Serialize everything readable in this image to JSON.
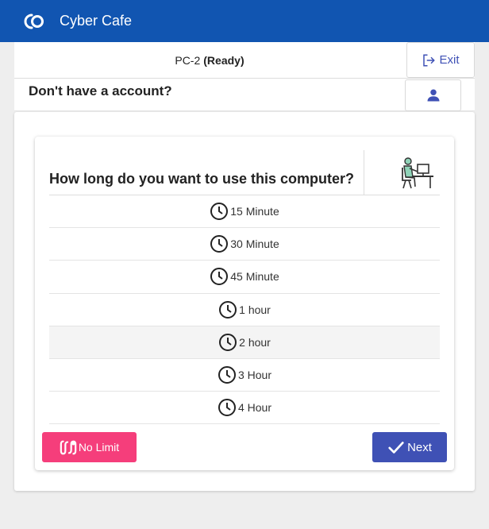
{
  "app": {
    "title": "Cyber Cafe",
    "logo_icon": "cyber-cafe-logo-icon"
  },
  "status": {
    "pc_name": "PC-2",
    "state": "(Ready)"
  },
  "exit": {
    "label": "Exit",
    "icon": "logout-icon"
  },
  "account": {
    "prompt": "Don't have a account?",
    "icon": "person-icon"
  },
  "question": {
    "text": "How long do you want to use this computer?",
    "illustration": "person-at-computer-illustration"
  },
  "options": [
    {
      "label": "15 Minute",
      "icon": "clock-icon"
    },
    {
      "label": "30 Minute",
      "icon": "clock-icon"
    },
    {
      "label": "45 Minute",
      "icon": "clock-icon"
    },
    {
      "label": "1 hour",
      "icon": "clock-icon"
    },
    {
      "label": "2 hour",
      "icon": "clock-icon",
      "selected": true
    },
    {
      "label": "3 Hour",
      "icon": "clock-icon"
    },
    {
      "label": "4 Hour",
      "icon": "clock-icon"
    }
  ],
  "actions": {
    "no_limit": "No Limit",
    "next": "Next"
  },
  "colors": {
    "appbar": "#1155b1",
    "primary": "#3f51b5",
    "accent": "#f53e7b",
    "selected_row": "#f4f4f4"
  }
}
